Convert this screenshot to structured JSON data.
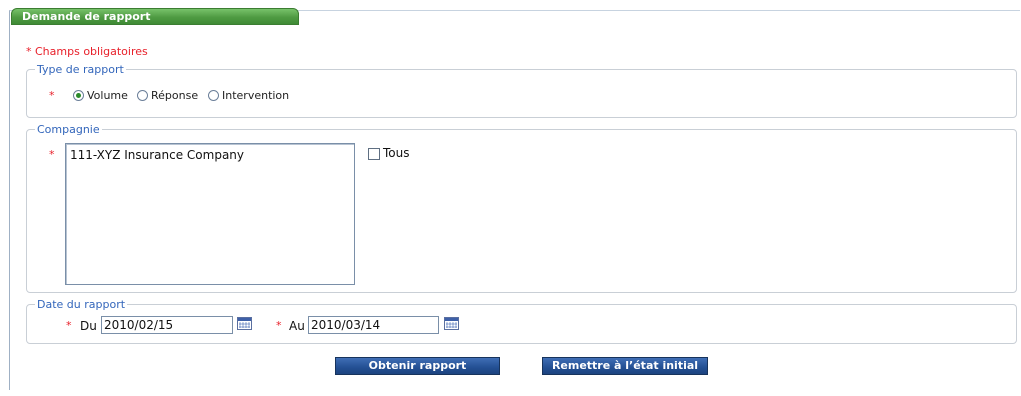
{
  "panel": {
    "title": "Demande de rapport"
  },
  "required_note": "* Champs obligatoires",
  "required_marker": "*",
  "report_type": {
    "legend": "Type de rapport",
    "options": [
      {
        "label": "Volume",
        "selected": true
      },
      {
        "label": "Réponse",
        "selected": false
      },
      {
        "label": "Intervention",
        "selected": false
      }
    ]
  },
  "company": {
    "legend": "Compagnie",
    "list_items": [
      "111-XYZ Insurance Company"
    ],
    "all_checkbox_label": "Tous",
    "all_checked": false
  },
  "report_date": {
    "legend": "Date du rapport",
    "from_label": "Du",
    "from_value": "2010/02/15",
    "to_label": "Au",
    "to_value": "2010/03/14"
  },
  "buttons": {
    "get_report": "Obtenir rapport",
    "reset": "Remettre à l’état initial"
  },
  "colors": {
    "tab_green": "#4f9b43",
    "required_red": "#e8202a",
    "legend_blue": "#3366bb",
    "button_blue": "#234f93"
  }
}
